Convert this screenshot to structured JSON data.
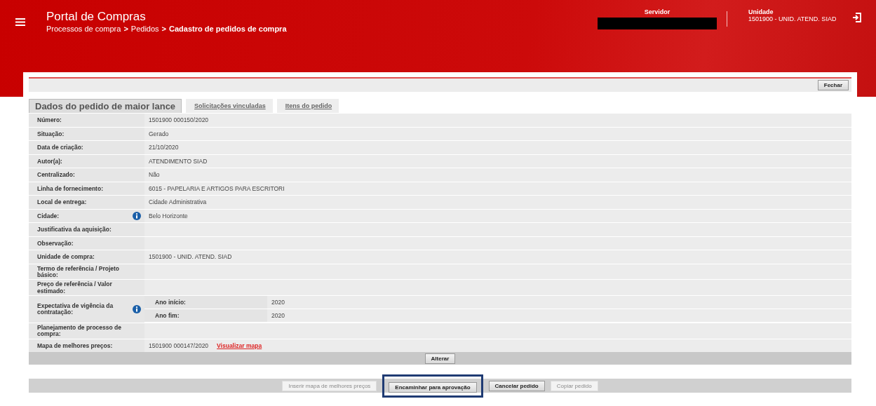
{
  "header": {
    "title": "Portal de Compras",
    "breadcrumb": [
      "Processos de compra",
      "Pedidos"
    ],
    "breadcrumb_separators": [
      ">",
      ">"
    ],
    "breadcrumb_current": "Cadastro de pedidos de compra",
    "servidor_label": "Servidor",
    "unidade_label": "Unidade",
    "unidade_value": "1501900 - UNID. ATEND. SIAD"
  },
  "toolbar": {
    "close_button": "Fechar"
  },
  "tabs": [
    {
      "label": "Dados do pedido de maior lance",
      "selected": true
    },
    {
      "label": "Solicitações vinculadas",
      "selected": false
    },
    {
      "label": "Itens do pedido",
      "selected": false
    }
  ],
  "rows": [
    {
      "kind": "text",
      "label": "Número:",
      "value": "1501900 000150/2020",
      "info": false
    },
    {
      "kind": "text",
      "label": "Situação:",
      "value": "Gerado",
      "info": false
    },
    {
      "kind": "text",
      "label": "Data de criação:",
      "value": "21/10/2020",
      "info": false
    },
    {
      "kind": "text",
      "label": "Autor(a):",
      "value": "ATENDIMENTO SIAD",
      "info": false
    },
    {
      "kind": "text",
      "label": "Centralizado:",
      "value": "Não",
      "info": false
    },
    {
      "kind": "text",
      "label": "Linha de fornecimento:",
      "value": "6015 - PAPELARIA E ARTIGOS PARA ESCRITORI",
      "info": false
    },
    {
      "kind": "text",
      "label": "Local de entrega:",
      "value": "Cidade Administrativa",
      "info": false
    },
    {
      "kind": "text",
      "label": "Cidade:",
      "value": "Belo Horizonte",
      "info": true
    },
    {
      "kind": "text",
      "label": "Justificativa da aquisição:",
      "info": false
    },
    {
      "kind": "text",
      "label": "Observação:",
      "info": false
    },
    {
      "kind": "text",
      "label": "Unidade de compra:",
      "value": "1501900 - UNID. ATEND. SIAD",
      "info": false
    },
    {
      "kind": "text",
      "label": "Termo de referência / Projeto básico:",
      "info": false
    },
    {
      "kind": "text",
      "label": "Preço de referência / Valor estimado:",
      "info": false
    },
    {
      "kind": "sub",
      "label": "Expectativa de vigência da contratação:",
      "info": true,
      "sub": [
        {
          "label": "Ano início:",
          "value": "2020"
        },
        {
          "label": "Ano fim:",
          "value": "2020"
        }
      ]
    },
    {
      "kind": "text",
      "label": "Planejamento de processo de compra:",
      "info": false
    },
    {
      "kind": "link",
      "label": "Mapa de melhores preços:",
      "value": "1501900 000147/2020",
      "link": "Visualizar mapa",
      "info": false
    }
  ],
  "edit_button": "Alterar",
  "actions": [
    {
      "label": "Inserir mapa de melhores preços",
      "disabled": true,
      "highlighted": false
    },
    {
      "label": "Encaminhar para aprovação",
      "disabled": false,
      "highlighted": true
    },
    {
      "label": "Cancelar pedido",
      "disabled": false,
      "highlighted": false
    },
    {
      "label": "Copiar pedido",
      "disabled": true,
      "highlighted": false
    }
  ]
}
